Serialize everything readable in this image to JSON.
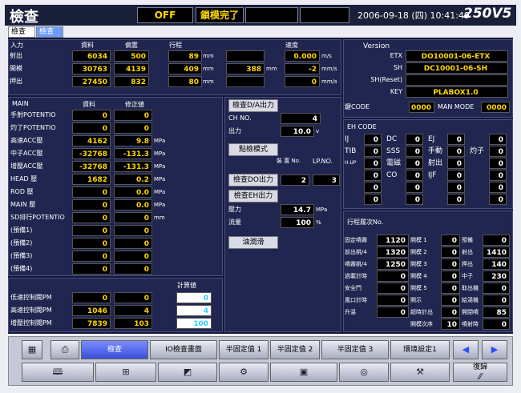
{
  "titlebar": {
    "title": "檢查",
    "mode": "OFF",
    "status": "鎖模完了",
    "datetime": "2006-09-18 (四)  10:41:49",
    "version": "250V5"
  },
  "tabs": [
    "檢查 1",
    "檢查 2"
  ],
  "input_section": {
    "header": "入力",
    "col_data": "資料",
    "col_dev": "偏置",
    "col_stroke": "行程",
    "col_speed": "速度",
    "rows": [
      {
        "label": "射出",
        "data": "6034",
        "dev": "500",
        "stroke": "89",
        "stroke_unit": "mm",
        "mid": "",
        "speed": "0.000",
        "speed_unit": "m/s"
      },
      {
        "label": "開模",
        "data": "30763",
        "dev": "4139",
        "stroke": "409",
        "stroke_unit": "mm",
        "mid": "388",
        "mid_unit": "mm",
        "speed": "-2",
        "speed_unit": "mm/s"
      },
      {
        "label": "押出",
        "data": "27450",
        "dev": "832",
        "stroke": "80",
        "stroke_unit": "mm",
        "mid": "",
        "speed": "0",
        "speed_unit": "mm/s"
      }
    ]
  },
  "main_section": {
    "header": "MAIN",
    "col_data": "資料",
    "col_corr": "修正値",
    "rows": [
      {
        "label": "手射POTENTIO",
        "data": "0",
        "corr": "0",
        "unit": ""
      },
      {
        "label": "灼了POTENTIO",
        "data": "0",
        "corr": "0",
        "unit": ""
      },
      {
        "label": "高速ACC壓",
        "data": "4162",
        "corr": "9.8",
        "unit": "MPa"
      },
      {
        "label": "中子ACC壓",
        "data": "-32768",
        "corr": "-131.3",
        "unit": "MPa"
      },
      {
        "label": "增壓ACC壓",
        "data": "-32768",
        "corr": "-131.3",
        "unit": "MPa"
      },
      {
        "label": "HEAD 壓",
        "data": "1682",
        "corr": "0.2",
        "unit": "MPa"
      },
      {
        "label": "ROD 壓",
        "data": "0",
        "corr": "0.0",
        "unit": "MPa"
      },
      {
        "label": "MAIN 壓",
        "data": "0",
        "corr": "0.0",
        "unit": "MPa"
      },
      {
        "label": "SD排行POTENTIO",
        "data": "0",
        "corr": "0",
        "unit": "mm"
      },
      {
        "label": "(預備1)",
        "data": "0",
        "corr": "0",
        "unit": ""
      },
      {
        "label": "(預備2)",
        "data": "0",
        "corr": "0",
        "unit": ""
      },
      {
        "label": "(預備3)",
        "data": "0",
        "corr": "0",
        "unit": ""
      },
      {
        "label": "(預備4)",
        "data": "0",
        "corr": "0",
        "unit": ""
      }
    ]
  },
  "pm_section": {
    "col_calc": "計算値",
    "rows": [
      {
        "label": "低速控制閥PM",
        "a": "0",
        "b": "0",
        "c": "0"
      },
      {
        "label": "高速控制閥PM",
        "a": "1046",
        "b": "4",
        "c": "4"
      },
      {
        "label": "增壓控制閥PM",
        "a": "7839",
        "b": "103",
        "c": "100"
      }
    ]
  },
  "middle": {
    "da_button": "檢查D/A出力",
    "ch_label": "CH NO.",
    "ch_value": "4",
    "out_label": "出力",
    "out_value": "10.0",
    "out_unit": "v",
    "point_button": "點檢模式",
    "dev_label": "裝\n置\nNo.",
    "lp_label": "LP.NO.",
    "do_button": "檢查DO出力",
    "do_dev": "2",
    "do_lp": "3",
    "eh_button": "檢查EH出力",
    "pressure_label": "壓力",
    "pressure_value": "14.7",
    "pressure_unit": "MPa",
    "flow_label": "流量",
    "flow_value": "100",
    "flow_unit": "%",
    "oil_button": "油潤滑"
  },
  "version_section": {
    "header": "Version",
    "rows": [
      {
        "label": "ETX",
        "value": "DO10001-06-ETX"
      },
      {
        "label": "SH",
        "value": "DC10001-06-SH"
      },
      {
        "label": "SH(Reset)",
        "value": ""
      },
      {
        "label": "KEY",
        "value": "PLABOX1.0"
      }
    ],
    "code_label": "鍵CODE",
    "code_value": "0000",
    "man_label": "MAN MODE",
    "man_value": "0000"
  },
  "eh_section": {
    "header": "EH CODE",
    "labels": [
      "IJ",
      "DC",
      "EJ",
      "",
      "TIB",
      "SSS",
      "手動",
      "灼子",
      "H.UP",
      "電磁",
      "射出",
      "",
      "",
      "CO",
      "IJF",
      ""
    ],
    "values": [
      "0",
      "0",
      "0",
      "0",
      "0",
      "0",
      "0",
      "0",
      "0",
      "0",
      "0",
      "0",
      "0",
      "0",
      "0",
      "0",
      "0",
      "0",
      "0",
      "0",
      "0",
      "0",
      "0",
      "0"
    ]
  },
  "process_section": {
    "header": "行程履次No.",
    "rows": [
      {
        "l1": "固定噴霧",
        "v1": "1120",
        "l2": "開模 1",
        "v2": "0",
        "l3": "預備",
        "v3": "0"
      },
      {
        "l1": "前出桃/4",
        "v1": "1320",
        "l2": "開模 2",
        "v2": "0",
        "l3": "射出",
        "v3": "1410"
      },
      {
        "l1": "噴霧桃/4",
        "v1": "1250",
        "l2": "開模 3",
        "v2": "0",
        "l3": "押出",
        "v3": "140"
      },
      {
        "l1": "過載計時",
        "v1": "0",
        "l2": "開模 4",
        "v2": "0",
        "l3": "中子",
        "v3": "230"
      },
      {
        "l1": "安全門",
        "v1": "0",
        "l2": "開模 5",
        "v2": "0",
        "l3": "取出機",
        "v3": "0"
      },
      {
        "l1": "風口計時",
        "v1": "0",
        "l2": "開示",
        "v2": "0",
        "l3": "給湯機",
        "v3": "0"
      },
      {
        "l1": "升温",
        "v1": "0",
        "l2": "超時計出",
        "v2": "0",
        "l3": "開閉噴",
        "v3": "85"
      },
      {
        "l1": "",
        "v1": "",
        "l2": "開模次序",
        "v2": "10",
        "l3": "噴射時",
        "v3": "0"
      }
    ]
  },
  "bottom_bar": {
    "row1": [
      "檢查",
      "IO檢查畫面",
      "半固定值 1",
      "半固定值 2",
      "半固定值 3",
      "環境設定1"
    ],
    "restore": "復歸"
  }
}
